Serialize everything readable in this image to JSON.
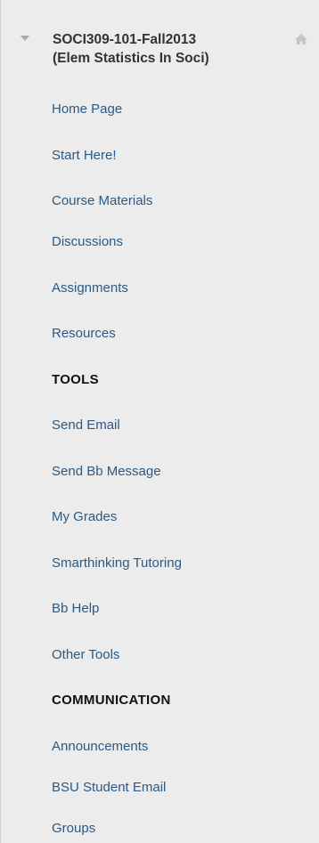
{
  "course": {
    "title_line1": "SOCI309-101-Fall2013",
    "title_line2": "(Elem Statistics In Soci)"
  },
  "menu": {
    "home_page": "Home Page",
    "start_here": "Start Here!",
    "course_materials": "Course Materials",
    "discussions": "Discussions",
    "assignments": "Assignments",
    "resources": "Resources"
  },
  "tools": {
    "heading": "TOOLS",
    "send_email": "Send Email",
    "send_bb_message": "Send Bb Message",
    "my_grades": "My Grades",
    "smarthinking_tutoring": "Smarthinking Tutoring",
    "bb_help": "Bb Help",
    "other_tools": "Other Tools"
  },
  "communication": {
    "heading": "COMMUNICATION",
    "announcements": "Announcements",
    "bsu_student_email": "BSU Student Email",
    "groups": "Groups"
  },
  "icons": {
    "collapse": "triangle-down-icon",
    "home": "home-icon"
  },
  "colors": {
    "link": "#2a5a86",
    "heading": "#111111",
    "background": "#ececec"
  }
}
